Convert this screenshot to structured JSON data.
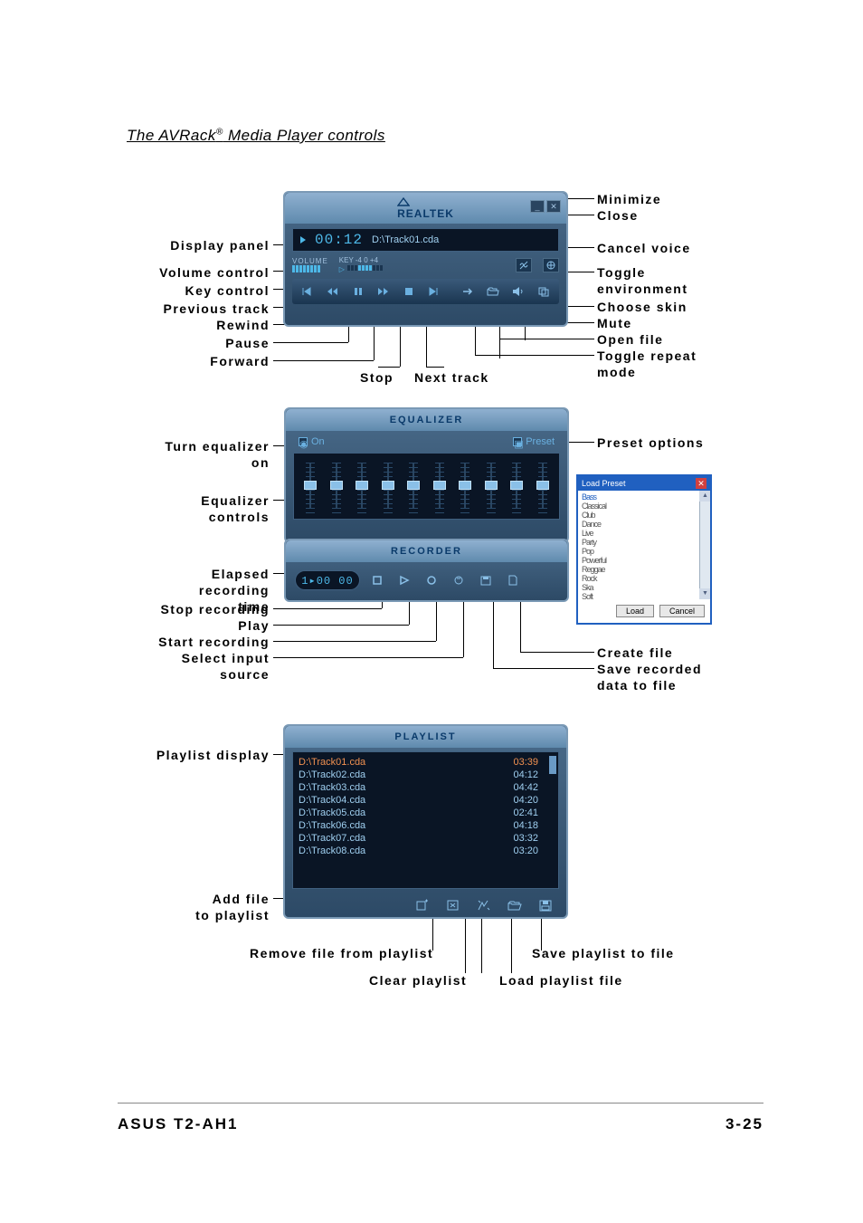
{
  "title": {
    "pre": "The AVRack",
    "post": " Media Player controls"
  },
  "footer": {
    "left": "ASUS T2-AH1",
    "right": "3-25"
  },
  "labels": {
    "minimize": "Minimize",
    "close": "Close",
    "cancel_voice": "Cancel voice",
    "toggle_env": "Toggle\nenvironment",
    "choose_skin": "Choose skin",
    "mute": "Mute",
    "open_file": "Open file",
    "toggle_repeat": "Toggle repeat\nmode",
    "display_panel": "Display panel",
    "volume_control": "Volume control",
    "key_control": "Key control",
    "previous_track": "Previous track",
    "rewind": "Rewind",
    "pause": "Pause",
    "forward": "Forward",
    "stop": "Stop",
    "next_track": "Next track",
    "turn_eq_on": "Turn equalizer\non",
    "eq_controls": "Equalizer\ncontrols",
    "preset_options": "Preset options",
    "elapsed": "Elapsed\nrecording time",
    "stop_rec": "Stop recording",
    "play": "Play",
    "start_rec": "Start recording",
    "select_input": "Select input\nsource",
    "create_file": "Create file",
    "save_recorded": "Save recorded\ndata to file",
    "playlist_display": "Playlist display",
    "add_file": "Add file\nto playlist",
    "remove_file": "Remove file from playlist",
    "clear_playlist": "Clear playlist",
    "load_playlist": "Load playlist file",
    "save_playlist": "Save playlist to file"
  },
  "player": {
    "brand": "REALTEK",
    "time": "00:12",
    "track": "D:\\Track01.cda",
    "volume_label": "VOLUME",
    "key_label": "KEY -4  0  +4"
  },
  "equalizer": {
    "header": "EQUALIZER",
    "on_label": "On",
    "preset_label": "Preset"
  },
  "recorder": {
    "header": "RECORDER",
    "time": "1▸00 00"
  },
  "preset_popup": {
    "title": "Load Preset",
    "items": [
      "Bass",
      "Classical",
      "Club",
      "Dance",
      "Live",
      "Party",
      "Pop",
      "Powerful",
      "Reggae",
      "Rock",
      "Ska",
      "Soft"
    ],
    "load_btn": "Load",
    "cancel_btn": "Cancel"
  },
  "playlist": {
    "header": "PLAYLIST",
    "tracks": [
      {
        "name": "D:\\Track01.cda",
        "time": "03:39"
      },
      {
        "name": "D:\\Track02.cda",
        "time": "04:12"
      },
      {
        "name": "D:\\Track03.cda",
        "time": "04:42"
      },
      {
        "name": "D:\\Track04.cda",
        "time": "04:20"
      },
      {
        "name": "D:\\Track05.cda",
        "time": "02:41"
      },
      {
        "name": "D:\\Track06.cda",
        "time": "04:18"
      },
      {
        "name": "D:\\Track07.cda",
        "time": "03:32"
      },
      {
        "name": "D:\\Track08.cda",
        "time": "03:20"
      }
    ]
  }
}
